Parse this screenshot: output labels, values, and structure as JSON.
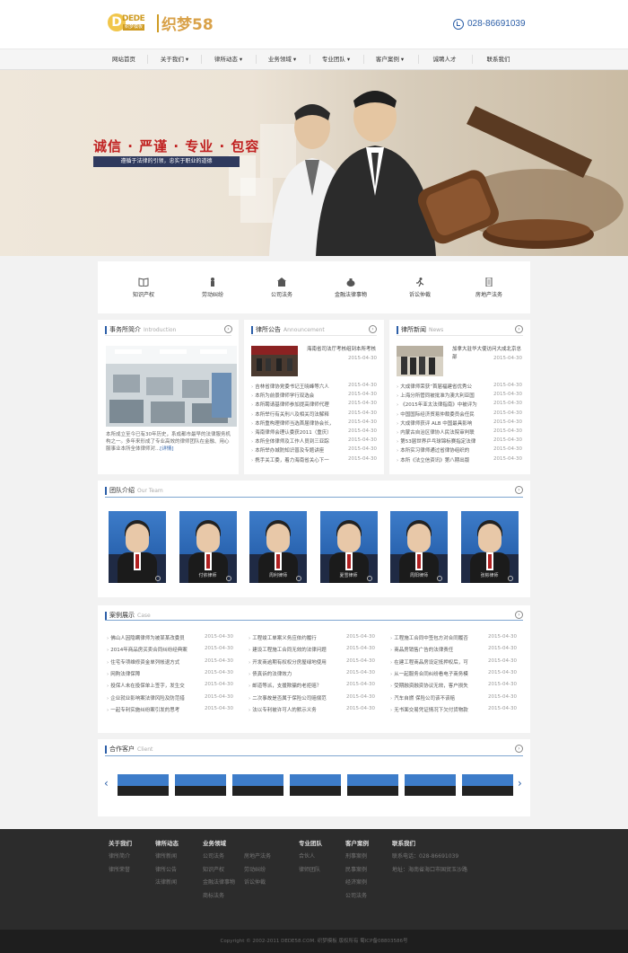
{
  "header": {
    "logo_letter": "D",
    "logo_brand": "DEDE",
    "logo_brand_sub": "织梦模板",
    "logo_name": "织梦58",
    "phone": "028-86691039",
    "phone_icon": "phone-icon"
  },
  "nav": {
    "items": [
      {
        "label": "网站首页"
      },
      {
        "label": "关于我们 ▾"
      },
      {
        "label": "律所动态 ▾"
      },
      {
        "label": "业务领域 ▾"
      },
      {
        "label": "专业团队 ▾"
      },
      {
        "label": "客户案例 ▾"
      },
      {
        "label": "诚聘人才"
      },
      {
        "label": "联系我们"
      }
    ]
  },
  "banner": {
    "slogan": "诚信 · 严谨 · 专业 · 包容",
    "subslogan": "遵循于法律的引领，忠实于职业的道德",
    "dots": [
      "1",
      "2",
      "3"
    ]
  },
  "services": [
    {
      "label": "知识产权",
      "icon": "book-icon"
    },
    {
      "label": "劳动纠纷",
      "icon": "worker-icon"
    },
    {
      "label": "公司法务",
      "icon": "building-icon"
    },
    {
      "label": "金融法律事物",
      "icon": "money-bag-icon"
    },
    {
      "label": "诉讼仲裁",
      "icon": "running-person-icon"
    },
    {
      "label": "房地产法务",
      "icon": "document-icon"
    }
  ],
  "intro": {
    "title": "事务所简介",
    "title_en": "Introduction",
    "text": "本所成立至今已有30年历史，系成都市最早的法律服务机构之一。多年来形成了专业高效的律师团队在金融、用心服事业本所全体律师对...",
    "more_link": "[详情]"
  },
  "announce": {
    "title": "律所公告",
    "title_en": "Announcement",
    "featured": {
      "title": "海南省司法厅考核组到本所考核",
      "date": "2015-04-30"
    },
    "items": [
      {
        "text": "吉林省律协党委书记王晓峰等六人",
        "date": "2015-04-30"
      },
      {
        "text": "本所为前景律师学行双选会",
        "date": "2015-04-30"
      },
      {
        "text": "本所聘请基律师参加提高律师代理",
        "date": "2015-04-30"
      },
      {
        "text": "本所举行有关刑八及相关司法解释",
        "date": "2015-04-30"
      },
      {
        "text": "本所重构理律师当选首届律协会长，",
        "date": "2015-04-30"
      },
      {
        "text": "海南律师会理认委获2011（重庆）",
        "date": "2015-04-30"
      },
      {
        "text": "本所全体律师及工作人员到三亚踪",
        "date": "2015-04-30"
      },
      {
        "text": "本所举办城防知识普及专题讲座",
        "date": "2015-04-30"
      },
      {
        "text": "携手关工委，着力海南省关心下一",
        "date": "2015-04-30"
      }
    ]
  },
  "news": {
    "title": "律所新闻",
    "title_en": "News",
    "featured": {
      "title": "加拿大驻华大使访问大成北京总部",
      "date": "2015-04-30"
    },
    "items": [
      {
        "text": "大成律师荣获“首届福建省优秀公",
        "date": "2015-04-30"
      },
      {
        "text": "上海分所管同被批准为澳大利亚国",
        "date": "2015-04-30"
      },
      {
        "text": "《2015年亚太法律指南》中被评为",
        "date": "2015-04-30"
      },
      {
        "text": "中国国际经济贸易仲裁委员会任民",
        "date": "2015-04-30"
      },
      {
        "text": "大成律师获评 ALB 中国最具影响",
        "date": "2015-04-30"
      },
      {
        "text": "内蒙古自治区律协人民法院审判联",
        "date": "2015-04-30"
      },
      {
        "text": "第53届世界乒乓球锦标赛指定法律",
        "date": "2015-04-30"
      },
      {
        "text": "本所实习律师通过省律协组织的",
        "date": "2015-04-30"
      },
      {
        "text": "本所《法立信资讯》第八期出版",
        "date": "2015-04-30"
      }
    ]
  },
  "team": {
    "title": "团队介绍",
    "title_en": "Our Team",
    "members": [
      {
        "name": ""
      },
      {
        "name": "付依律师"
      },
      {
        "name": "周利律师"
      },
      {
        "name": "夏雪律师"
      },
      {
        "name": "周阳律师"
      },
      {
        "name": "张彬律师"
      }
    ]
  },
  "cases": {
    "title": "案例展示",
    "title_en": "Case",
    "columns": [
      [
        {
          "text": "佛山人因隐瞒律师为被某某改委员",
          "date": "2015-04-30"
        },
        {
          "text": "2014年商品房买卖合同纠纷经典案",
          "date": "2015-04-30"
        },
        {
          "text": "住宅专项维修资金单列帐退方式",
          "date": "2015-04-30"
        },
        {
          "text": "网购法律保障",
          "date": "2015-04-30"
        },
        {
          "text": "投保人未在投保单上签字，发生交",
          "date": "2015-04-30"
        },
        {
          "text": "企业就业影响案法律风险及防范措",
          "date": "2015-04-30"
        },
        {
          "text": "一起专利实施纠纷案引发的思考",
          "date": "2015-04-30"
        }
      ],
      [
        {
          "text": "工程竣工单案义务应依约履行",
          "date": "2015-04-30"
        },
        {
          "text": "建设工程施工合同无效的法律问题",
          "date": "2015-04-30"
        },
        {
          "text": "开发商逾期有权权分房屋绿地使用",
          "date": "2015-04-30"
        },
        {
          "text": "债真诉的法律效力",
          "date": "2015-04-30"
        },
        {
          "text": "邮道等派，支援欺骗的老拒赔？",
          "date": "2015-04-30"
        },
        {
          "text": "二次事故是否属于保险公司赔偿范",
          "date": "2015-04-30"
        },
        {
          "text": "法以专利被许可人的默示义务",
          "date": "2015-04-30"
        }
      ],
      [
        {
          "text": "工程施工合同中签包方对合同履否",
          "date": "2015-04-30"
        },
        {
          "text": "商品房销售广告的法律责任",
          "date": "2015-04-30"
        },
        {
          "text": "在建工程商品房设定抵押权后，可",
          "date": "2015-04-30"
        },
        {
          "text": "从一起服务合同纠纷看电子商务模",
          "date": "2015-04-30"
        },
        {
          "text": "受期融资融资协议无效，客户损失",
          "date": "2015-04-30"
        },
        {
          "text": "汽车自燃 保险公司该不该赔",
          "date": "2015-04-30"
        },
        {
          "text": "无书面交易凭证情况下欠付货物款",
          "date": "2015-04-30"
        }
      ]
    ]
  },
  "clients": {
    "title": "合作客户",
    "title_en": "Client",
    "prev": "‹",
    "next": "›"
  },
  "footer": {
    "columns": [
      {
        "title": "关于我们",
        "links": [
          "律所简介",
          "律所荣誉"
        ]
      },
      {
        "title": "律所动态",
        "links": [
          "律所新闻",
          "律所公告",
          "法律新闻"
        ]
      },
      {
        "title": "业务领域",
        "links": [
          "公司法务",
          "知识产权",
          "金融法律事物",
          "商标法务"
        ]
      },
      {
        "title": "",
        "links": [
          "房地产法务",
          "劳动纠纷",
          "诉讼仲裁"
        ]
      },
      {
        "title": "专业团队",
        "links": [
          "合伙人",
          "律师团队"
        ]
      },
      {
        "title": "客户案例",
        "links": [
          "刑事案例",
          "民事案例",
          "经济案例",
          "公司法务"
        ]
      },
      {
        "title": "联系我们",
        "links": [
          "联系电话：028-86691039",
          "地址：海南省海口市国贸玉沙路"
        ]
      }
    ],
    "copyright": "Copyright © 2002-2011 DEDE58.COM. 织梦模板 版权所有 蜀ICP备08803586号"
  },
  "colors": {
    "accent": "#2c5fa8",
    "slogan_red": "#c02020",
    "footer_bg": "#2c2c2c"
  }
}
